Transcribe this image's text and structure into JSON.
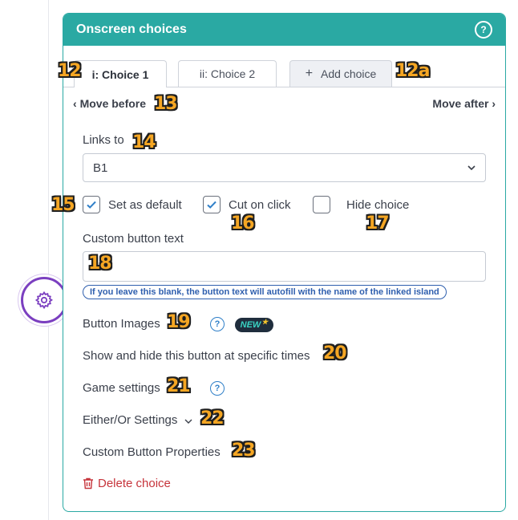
{
  "panel": {
    "title": "Onscreen choices",
    "help": "?"
  },
  "tabs": [
    {
      "label": "i: Choice 1"
    },
    {
      "label": "ii: Choice 2"
    },
    {
      "label": "Add choice",
      "icon": "+"
    }
  ],
  "move": {
    "before": "Move before",
    "after": "Move after"
  },
  "links_to": {
    "label": "Links to",
    "value": "B1"
  },
  "checkboxes": [
    {
      "label": "Set as default",
      "checked": true
    },
    {
      "label": "Cut on click",
      "checked": true
    },
    {
      "label": "Hide choice",
      "checked": false
    }
  ],
  "custom_text": {
    "label": "Custom button text",
    "value": "",
    "hint": "If you leave this blank, the button text will autofill with the name of the linked island"
  },
  "button_images": {
    "label": "Button Images",
    "badge": "NEW"
  },
  "show_hide": {
    "label": "Show and hide this button at specific times"
  },
  "game_settings": {
    "label": "Game settings"
  },
  "either_or": {
    "label": "Either/Or Settings"
  },
  "custom_props": {
    "label": "Custom Button Properties"
  },
  "delete": {
    "label": "Delete choice"
  },
  "callouts": {
    "c12": "12",
    "c12a": "12a",
    "c13": "13",
    "c14": "14",
    "c15": "15",
    "c16": "16",
    "c17": "17",
    "c18": "18",
    "c19": "19",
    "c20": "20",
    "c21": "21",
    "c22": "22",
    "c23": "23"
  },
  "colors": {
    "teal": "#2aa9a3",
    "purple": "#7b3fc0",
    "danger": "#c6343b",
    "link_blue": "#2f7fc8"
  }
}
